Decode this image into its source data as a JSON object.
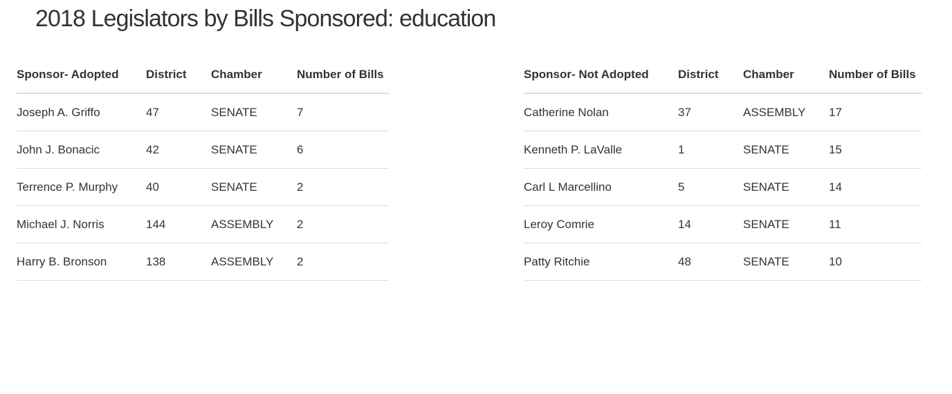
{
  "title": "2018 Legislators by Bills Sponsored: education",
  "adopted": {
    "headers": [
      "Sponsor- Adopted",
      "District",
      "Chamber",
      "Number of Bills"
    ],
    "rows": [
      [
        "Joseph A. Griffo",
        "47",
        "SENATE",
        "7"
      ],
      [
        "John J. Bonacic",
        "42",
        "SENATE",
        "6"
      ],
      [
        "Terrence P. Murphy",
        "40",
        "SENATE",
        "2"
      ],
      [
        "Michael J. Norris",
        "144",
        "ASSEMBLY",
        "2"
      ],
      [
        "Harry B. Bronson",
        "138",
        "ASSEMBLY",
        "2"
      ]
    ]
  },
  "not_adopted": {
    "headers": [
      "Sponsor- Not Adopted",
      "District",
      "Chamber",
      "Number of Bills"
    ],
    "rows": [
      [
        "Catherine Nolan",
        "37",
        "ASSEMBLY",
        "17"
      ],
      [
        "Kenneth P. LaValle",
        "1",
        "SENATE",
        "15"
      ],
      [
        "Carl L Marcellino",
        "5",
        "SENATE",
        "14"
      ],
      [
        "Leroy Comrie",
        "14",
        "SENATE",
        "11"
      ],
      [
        "Patty Ritchie",
        "48",
        "SENATE",
        "10"
      ]
    ]
  }
}
